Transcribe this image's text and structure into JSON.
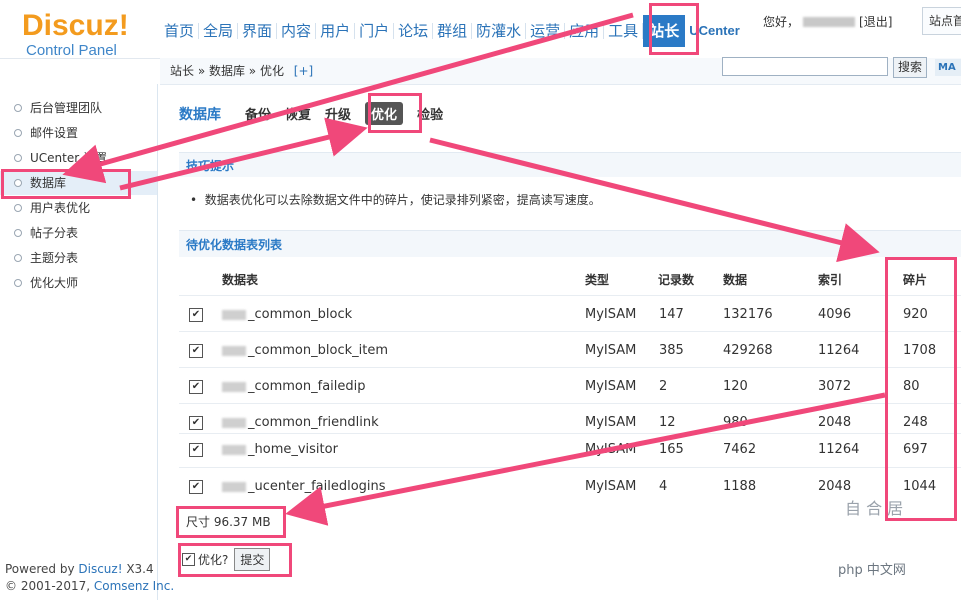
{
  "header": {
    "logo_main": "Discuz!",
    "logo_sub": "Control Panel",
    "nav": [
      "首页",
      "全局",
      "界面",
      "内容",
      "用户",
      "门户",
      "论坛",
      "群组",
      "防灌水",
      "运营",
      "应用",
      "工具"
    ],
    "nav_active": "站长",
    "nav_uc": "UCenter",
    "greeting": "您好，",
    "logout": "[退出]",
    "site_home": "站点首"
  },
  "breadcrumb": {
    "text": "站长 » 数据库 » 优化",
    "add": "[+]"
  },
  "search": {
    "button": "搜索",
    "map_label": "MA"
  },
  "sidebar": {
    "items": [
      "后台管理团队",
      "邮件设置",
      "UCenter 设置",
      "数据库",
      "用户表优化",
      "帖子分表",
      "主题分表",
      "优化大师"
    ]
  },
  "footer": {
    "powered": "Powered by ",
    "brand": "Discuz!",
    "version": " X3.4",
    "copyright": "© 2001-2017, ",
    "company": "Comsenz Inc."
  },
  "subnav": {
    "title": "数据库",
    "tabs": [
      "备份",
      "恢复",
      "升级",
      "优化",
      "检验"
    ]
  },
  "tips": {
    "header": "技巧提示",
    "text": "数据表优化可以去除数据文件中的碎片，使记录排列紧密，提高读写速度。"
  },
  "table": {
    "header": "待优化数据表列表",
    "columns": [
      "数据表",
      "类型",
      "记录数",
      "数据",
      "索引",
      "碎片"
    ],
    "rows": [
      {
        "name": "_common_block",
        "type": "MyISAM",
        "records": "147",
        "data": "132176",
        "index": "4096",
        "frag": "920"
      },
      {
        "name": "_common_block_item",
        "type": "MyISAM",
        "records": "385",
        "data": "429268",
        "index": "11264",
        "frag": "1708"
      },
      {
        "name": "_common_failedip",
        "type": "MyISAM",
        "records": "2",
        "data": "120",
        "index": "3072",
        "frag": "80"
      },
      {
        "name": "_common_friendlink",
        "type": "MyISAM",
        "records": "12",
        "data": "980",
        "index": "2048",
        "frag": "248"
      },
      {
        "name": "_home_visitor",
        "type": "MyISAM",
        "records": "165",
        "data": "7462",
        "index": "11264",
        "frag": "697"
      },
      {
        "name": "_ucenter_failedlogins",
        "type": "MyISAM",
        "records": "4",
        "data": "1188",
        "index": "2048",
        "frag": "1044"
      }
    ]
  },
  "size_text": "尺寸 96.37 MB",
  "optimize": {
    "label": "优化?",
    "submit": "提交"
  },
  "watermark": {
    "chars": "自 合 居",
    "site": "php 中文网"
  },
  "colors": {
    "highlight": "#f0487a",
    "nav_active": "#2b7ac6",
    "logo": "#f39b1e"
  }
}
